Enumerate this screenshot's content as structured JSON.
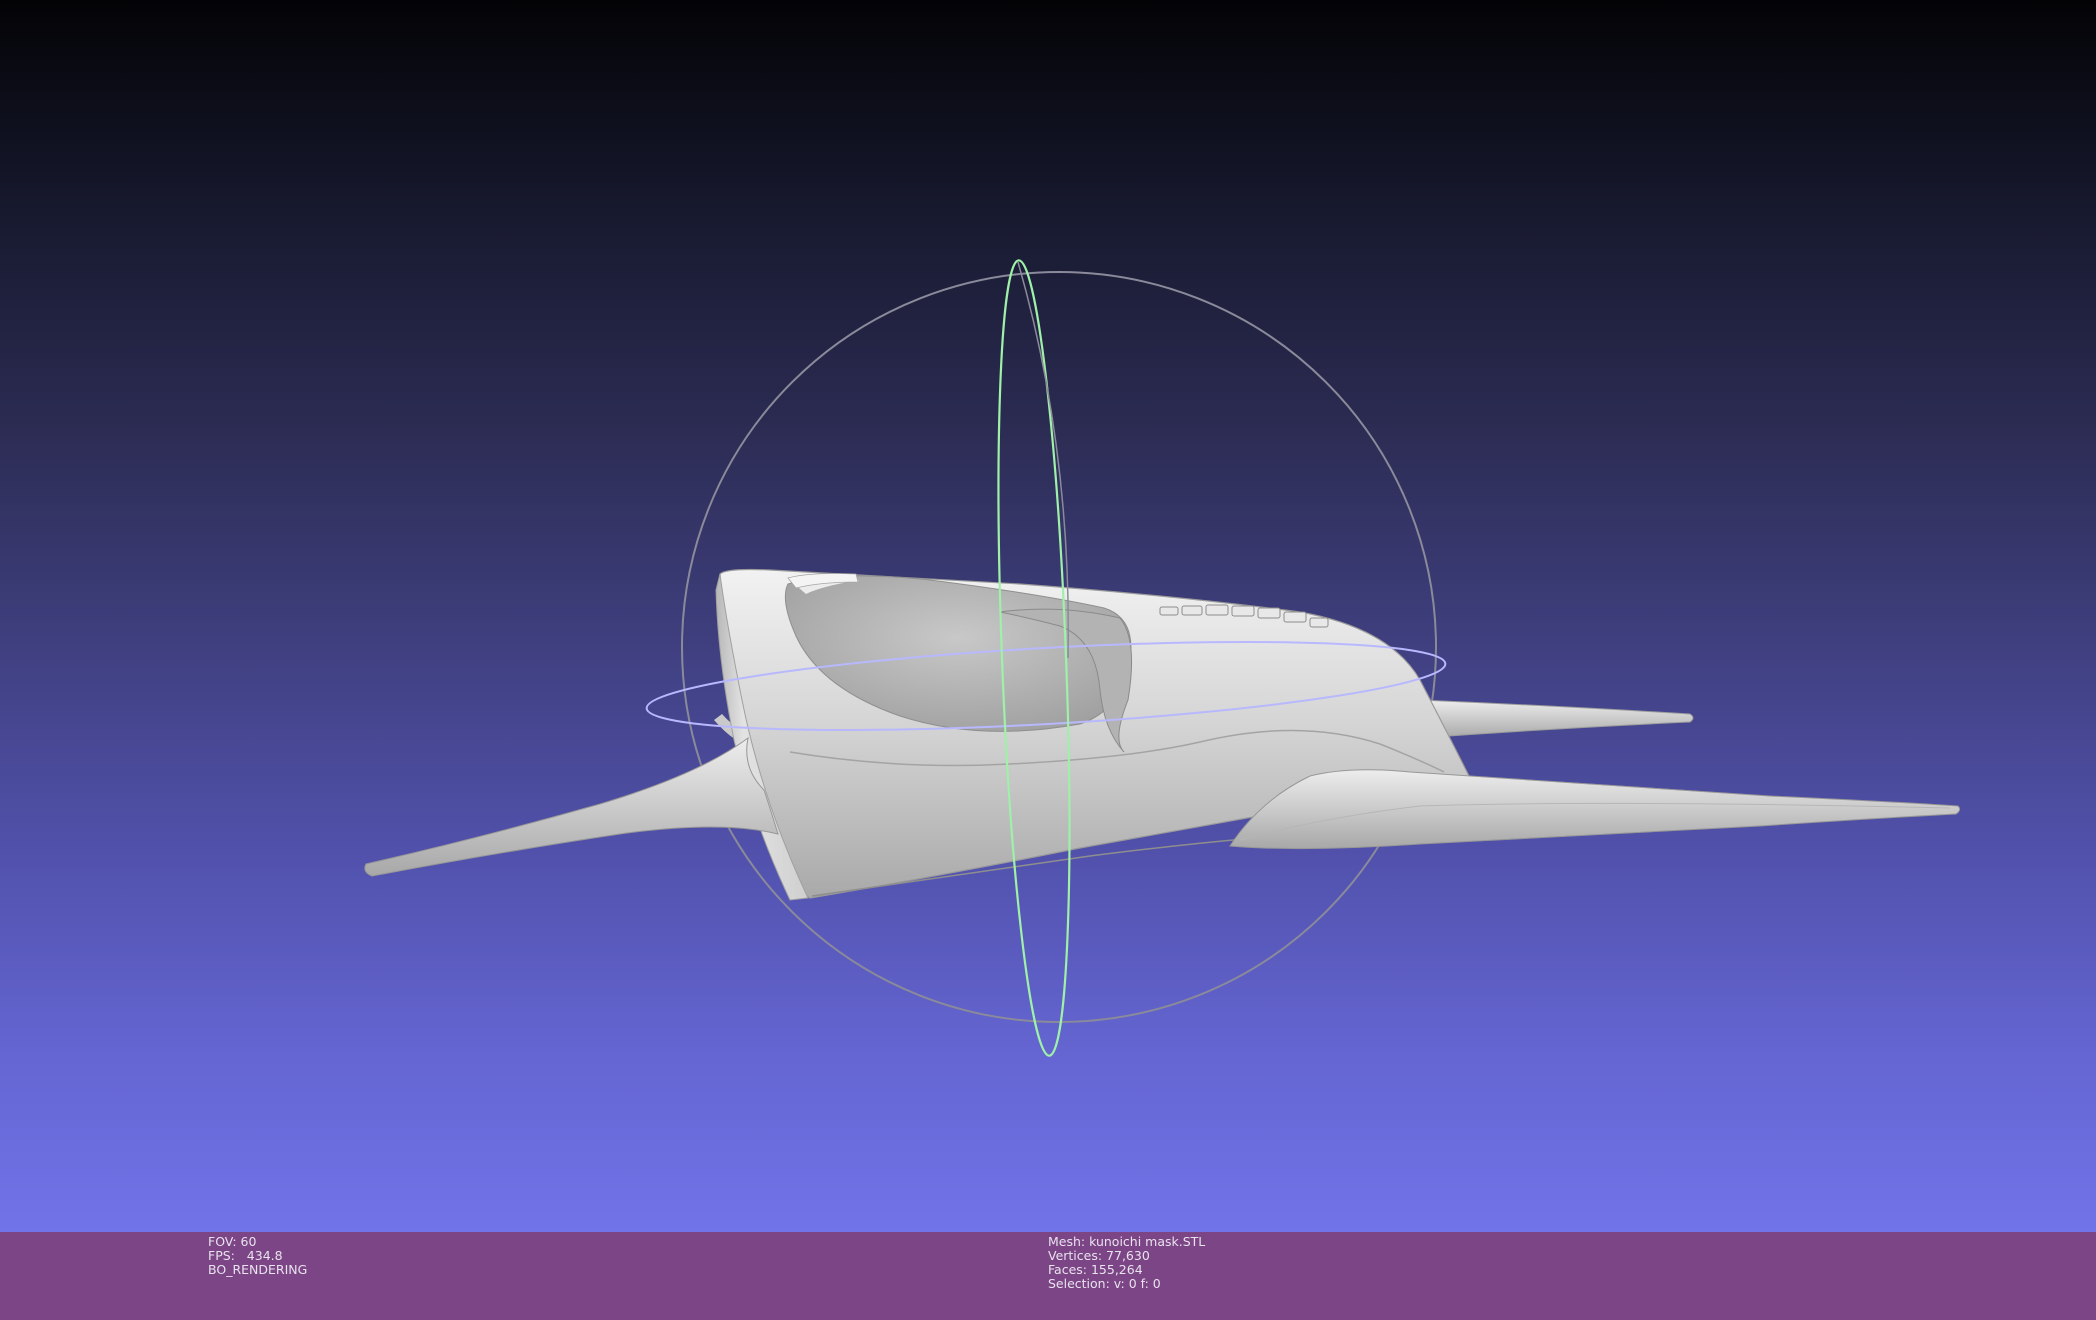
{
  "viewer": {
    "colors": {
      "background_top": "#030306",
      "background_bottom": "#7173e8",
      "info_bar": "#7c4585",
      "mesh": "#d9d9d9",
      "trackball_vertical": "#9ff0a8",
      "trackball_horizontal": "#b8b8ff",
      "trackball_outline": "#8a8a9a"
    }
  },
  "info": {
    "left": {
      "fov": "FOV: 60",
      "fps": "FPS:   434.8",
      "mode": "BO_RENDERING"
    },
    "right": {
      "mesh": "Mesh: kunoichi mask.STL",
      "vertices": "Vertices: 77,630",
      "faces": "Faces: 155,264",
      "selection": "Selection: v: 0 f: 0"
    }
  }
}
